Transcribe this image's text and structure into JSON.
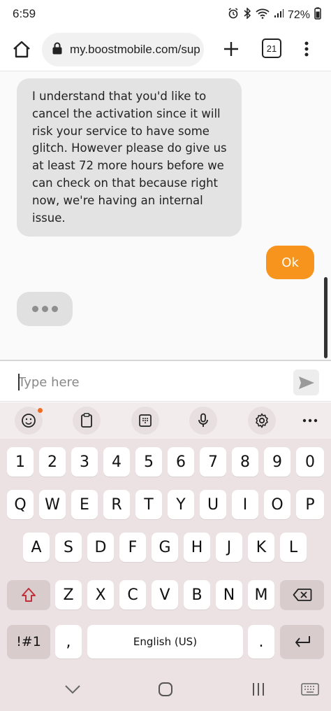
{
  "status": {
    "time": "6:59",
    "battery": "72%"
  },
  "browser": {
    "url": "my.boostmobile.com/sup",
    "tab_count": "21"
  },
  "chat": {
    "messages": [
      {
        "sender": "agent",
        "text": "I understand that you'd like to cancel the activation since it will risk your service to have some glitch. However please do give us at least 72 more hours before we can check on that because right now, we're having an internal issue."
      },
      {
        "sender": "user",
        "text": "Ok"
      }
    ],
    "typing_indicator": true
  },
  "input": {
    "placeholder": "Type here",
    "value": ""
  },
  "keyboard": {
    "toolbar": [
      "emoji-icon",
      "clipboard-icon",
      "keypad-icon",
      "mic-icon",
      "settings-icon",
      "more-icon"
    ],
    "row_numbers": [
      "1",
      "2",
      "3",
      "4",
      "5",
      "6",
      "7",
      "8",
      "9",
      "0"
    ],
    "row_top": [
      "Q",
      "W",
      "E",
      "R",
      "T",
      "Y",
      "U",
      "I",
      "O",
      "P"
    ],
    "row_middle": [
      "A",
      "S",
      "D",
      "F",
      "G",
      "H",
      "J",
      "K",
      "L"
    ],
    "row_bottom": [
      "Z",
      "X",
      "C",
      "V",
      "B",
      "N",
      "M"
    ],
    "symbols_label": "!#1",
    "comma": ",",
    "space_label": "English (US)",
    "period": "."
  },
  "colors": {
    "accent": "#f7941d",
    "agent_bubble": "#e3e3e3",
    "keyboard_bg": "#ece2e3"
  }
}
